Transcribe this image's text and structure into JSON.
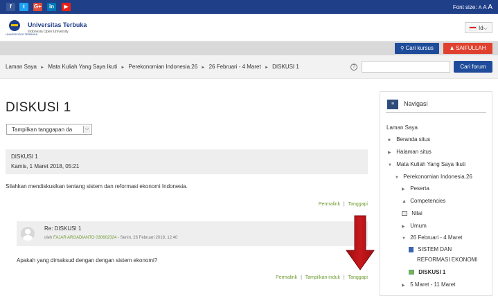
{
  "topbar": {
    "social": [
      {
        "icon": "facebook-icon",
        "glyph": "f",
        "color": "#3b5998"
      },
      {
        "icon": "twitter-icon",
        "glyph": "t",
        "color": "#1da1f2"
      },
      {
        "icon": "google-plus-icon",
        "glyph": "G+",
        "color": "#dd4b39"
      },
      {
        "icon": "linkedin-icon",
        "glyph": "in",
        "color": "#0077b5"
      },
      {
        "icon": "youtube-icon",
        "glyph": "▶",
        "color": "#e62117"
      }
    ],
    "font_size_label": "Font size:",
    "font_size_a": "A"
  },
  "header": {
    "brand_name": "Universitas Terbuka",
    "brand_sub": "Indonesia Open University",
    "logo_small": "UNIVERSITAS TERBUKA",
    "language": "Id",
    "lang_caret": "⌵"
  },
  "actions": {
    "search_courses": "Cari kursus",
    "user_name": "SAIFULLAH",
    "search_icon": "🔍",
    "user_icon": "♟"
  },
  "breadcrumb": {
    "items": [
      "Laman Saya",
      "Mata Kuliah Yang Saya Ikuti",
      "Perekonomian Indonesia.26",
      "26 Februari - 4 Maret",
      "DISKUSI 1"
    ],
    "separator": "►",
    "help_glyph": "?",
    "search_placeholder": "",
    "search_button": "Cari forum"
  },
  "main": {
    "page_title": "DISKUSI 1",
    "display_mode": "Tampilkan tanggapan da",
    "select_arrow": "⌵",
    "post": {
      "subject": "DISKUSI 1",
      "date": "Kamis, 1 Maret 2018, 05:21",
      "body": "Silahkan  mendiskusikan tentang sistem dan reformasi ekonomi Indonesia.",
      "link_permalink": "Permalink",
      "link_reply": "Tanggapi",
      "sep": "|"
    },
    "reply": {
      "subject": "Re: DISKUSI 1",
      "by": "oleh",
      "author": "FAJAR ARGADIANTO 030602324",
      "date": " - Senin, 26 Februari 2018, 12:40",
      "body": "Apakah  yang dimaksud dengan dengan sistem ekonomi?",
      "link_permalink": "Permalink",
      "link_parent": "Tampilkan induk",
      "link_reply": "Tanggapi",
      "sep": "|"
    }
  },
  "navigation": {
    "title": "Navigasi",
    "header_icon": "≡",
    "items": {
      "laman_saya": "Laman Saya",
      "beranda": "Beranda situs",
      "halaman": "Halaman situs",
      "mata_kuliah": "Mata Kuliah Yang Saya Ikuti",
      "perekonomian": "Perekonomian Indonesia.26",
      "peserta": "Peserta",
      "competencies": "Competencies",
      "nilai": "Nilai",
      "umum": "Umum",
      "week1": "26 Februari - 4 Maret",
      "sistem1": "SISTEM DAN",
      "sistem2": "REFORMASI EKONOMI",
      "diskusi": "DISKUSI 1",
      "week2": "5 Maret - 11 Maret"
    },
    "markers": {
      "bullet": "■",
      "collapsed": "▶",
      "expanded": "▼",
      "competency": "▲"
    }
  }
}
